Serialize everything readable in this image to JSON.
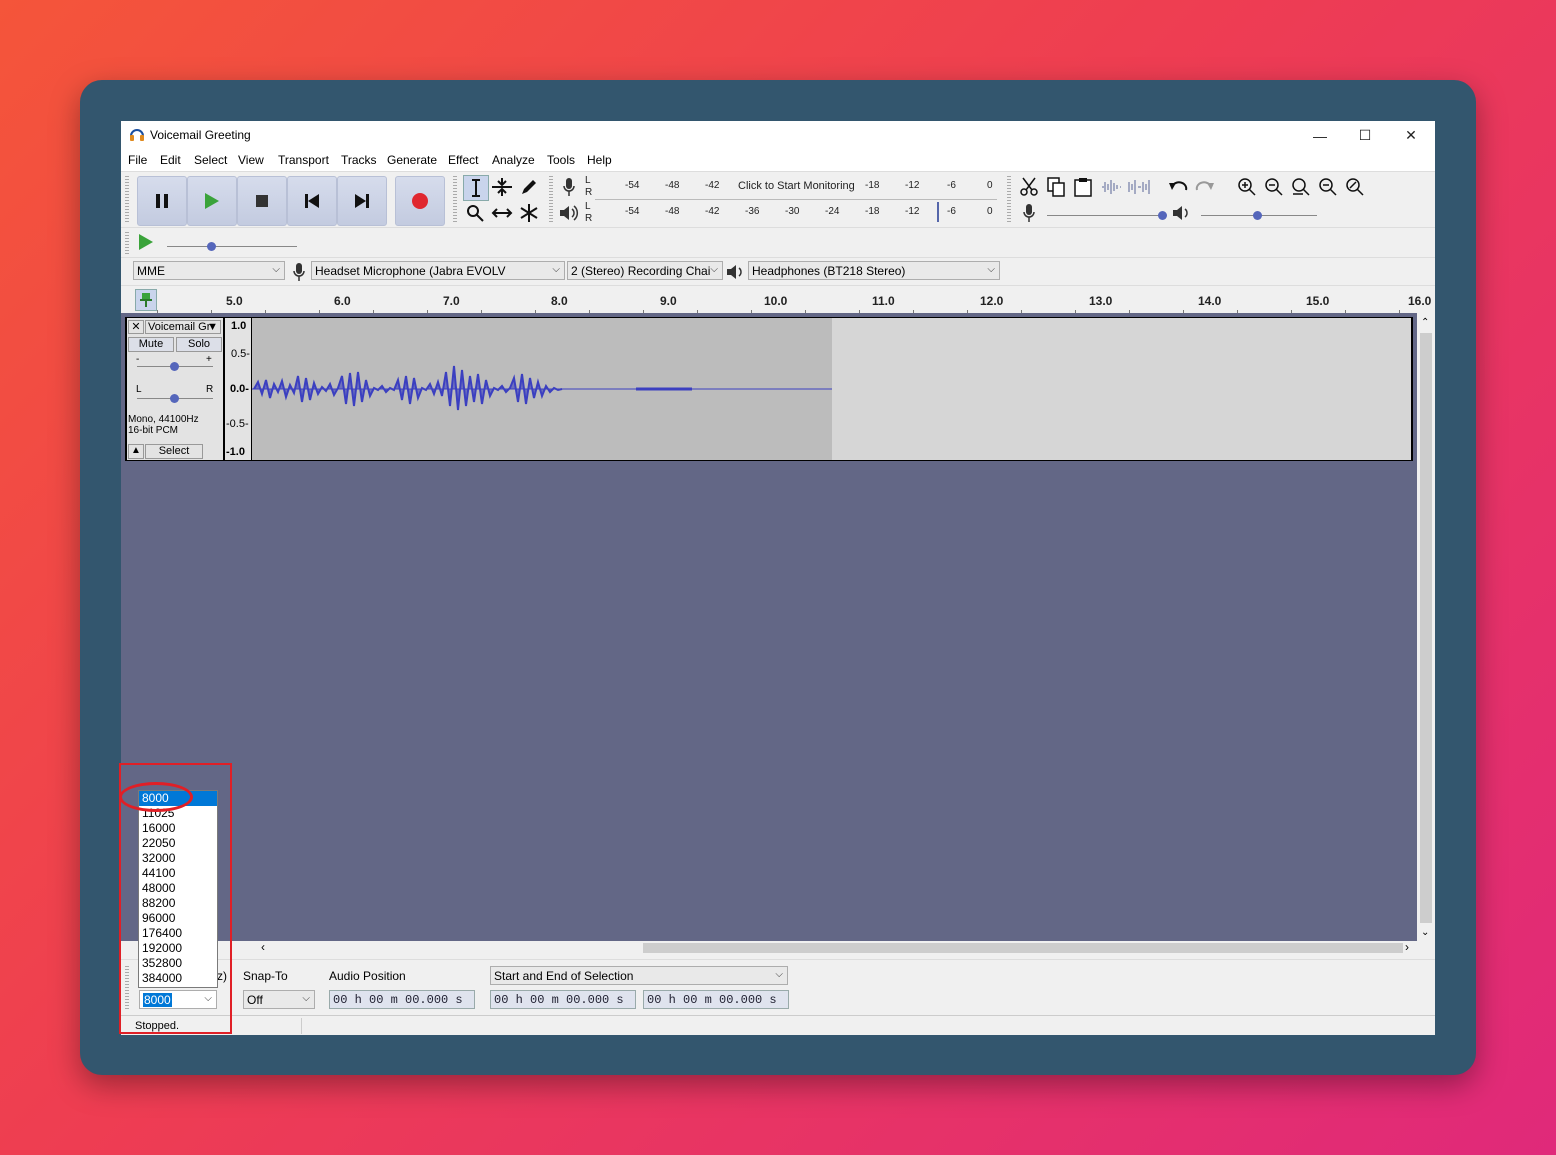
{
  "window": {
    "title": "Voicemail Greeting",
    "controls": {
      "minimize": "—",
      "maximize": "☐",
      "close": "✕"
    }
  },
  "menu": [
    "File",
    "Edit",
    "Select",
    "View",
    "Transport",
    "Tracks",
    "Generate",
    "Effect",
    "Analyze",
    "Tools",
    "Help"
  ],
  "meters": {
    "record_scale": [
      "-54",
      "-48",
      "-42",
      "-18",
      "-12",
      "-6",
      "0"
    ],
    "record_monitor_text": "Click to Start Monitoring",
    "playback_scale": [
      "-54",
      "-48",
      "-42",
      "-36",
      "-30",
      "-24",
      "-18",
      "-12",
      "-6",
      "0"
    ],
    "lr": [
      "L",
      "R"
    ]
  },
  "devices": {
    "host": "MME",
    "recording_device": "Headset Microphone (Jabra EVOLV",
    "recording_channels": "2 (Stereo) Recording Chai",
    "playback_device": "Headphones (BT218 Stereo)"
  },
  "ruler": [
    "5.0",
    "6.0",
    "7.0",
    "8.0",
    "9.0",
    "10.0",
    "11.0",
    "12.0",
    "13.0",
    "14.0",
    "15.0",
    "16.0"
  ],
  "track": {
    "name": "Voicemail Gr",
    "mute": "Mute",
    "solo": "Solo",
    "gain_minus": "-",
    "gain_plus": "+",
    "pan_left": "L",
    "pan_right": "R",
    "info_line1": "Mono, 44100Hz",
    "info_line2": "16-bit PCM",
    "select": "Select",
    "amplitude_labels": [
      "1.0",
      "0.5-",
      "0.0-",
      "-0.5-",
      "-1.0"
    ]
  },
  "selection_toolbar": {
    "rate_label_partial": "z)",
    "rate_value": "8000",
    "snap_label": "Snap-To",
    "snap_value": "Off",
    "audio_position_label": "Audio Position",
    "audio_position_value": "00 h 00 m 00.000 s",
    "selection_mode": "Start and End of Selection",
    "start_value": "00 h 00 m 00.000 s",
    "end_value": "00 h 00 m 00.000 s"
  },
  "rate_dropdown": {
    "options": [
      "8000",
      "11025",
      "16000",
      "22050",
      "32000",
      "44100",
      "48000",
      "88200",
      "96000",
      "176400",
      "192000",
      "352800",
      "384000"
    ],
    "selected": "8000"
  },
  "status": "Stopped.",
  "colors": {
    "background_start": "#f4553a",
    "background_end": "#e0297a",
    "frame": "#33566e",
    "track_area": "#636786",
    "waveform": "#3b3fc0",
    "highlight": "#e01f26",
    "selection_blue": "#0078d7"
  }
}
